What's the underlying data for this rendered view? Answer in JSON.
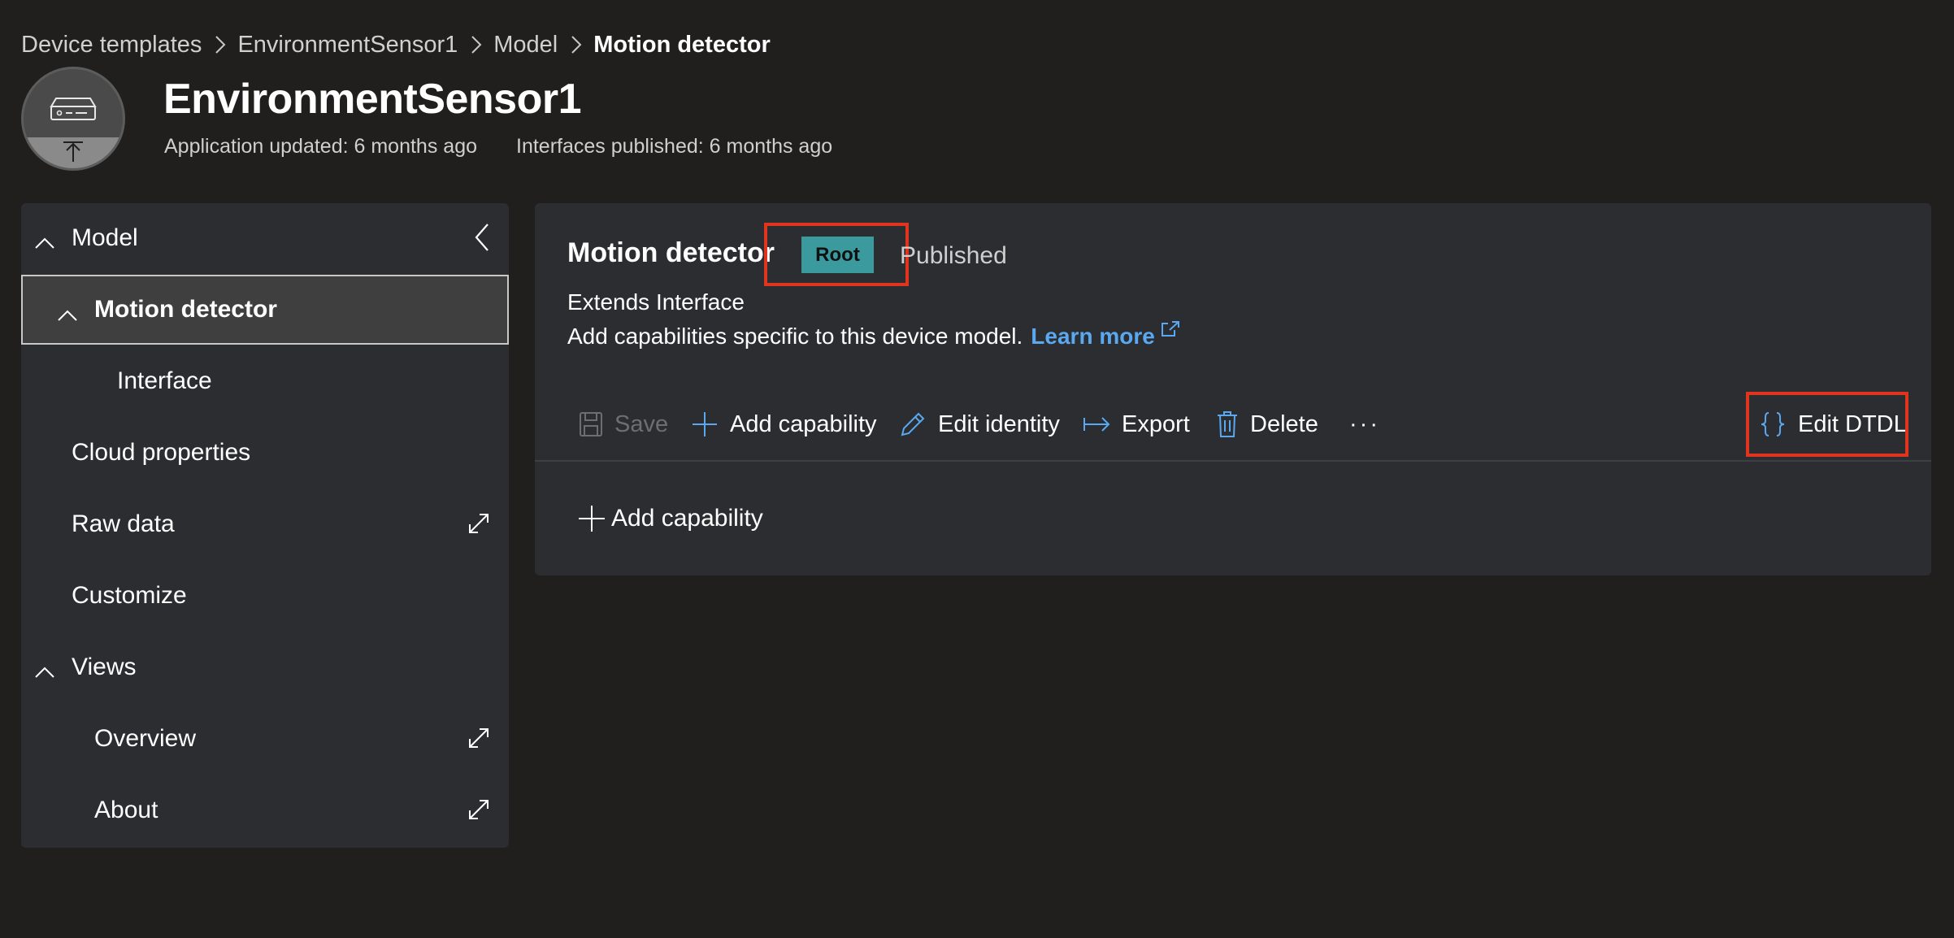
{
  "breadcrumb": {
    "items": [
      "Device templates",
      "EnvironmentSensor1",
      "Model"
    ],
    "current": "Motion detector"
  },
  "header": {
    "title": "EnvironmentSensor1",
    "application_updated": "Application updated: 6 months ago",
    "interfaces_published": "Interfaces published: 6 months ago",
    "avatar_icon": "device-upload-icon"
  },
  "sidebar": {
    "collapse_icon": "chevron-left-icon",
    "items": [
      {
        "label": "Model",
        "level": 0,
        "expandable": true
      },
      {
        "label": "Motion detector",
        "level": 1,
        "expandable": true,
        "selected": true
      },
      {
        "label": "Interface",
        "level": 2
      },
      {
        "label": "Cloud properties",
        "level": 0
      },
      {
        "label": "Raw data",
        "level": 0,
        "external": true
      },
      {
        "label": "Customize",
        "level": 0
      },
      {
        "label": "Views",
        "level": 0,
        "expandable": true
      },
      {
        "label": "Overview",
        "level": 1,
        "external": true
      },
      {
        "label": "About",
        "level": 1,
        "external": true
      }
    ]
  },
  "main": {
    "title": "Motion detector",
    "badge": "Root",
    "status": "Published",
    "extends": "Extends Interface",
    "description": "Add capabilities specific to this device model.",
    "learn_more": "Learn more",
    "toolbar": {
      "save": "Save",
      "add_capability": "Add capability",
      "edit_identity": "Edit identity",
      "export": "Export",
      "delete": "Delete",
      "more": "···",
      "edit_dtdl": "Edit DTDL"
    },
    "body_add_capability": "Add capability"
  },
  "colors": {
    "background": "#201f1e",
    "panel": "#2b2d31",
    "accent": "#5aa8f0",
    "badge": "#3a9a9e",
    "highlight": "#e0341f"
  }
}
